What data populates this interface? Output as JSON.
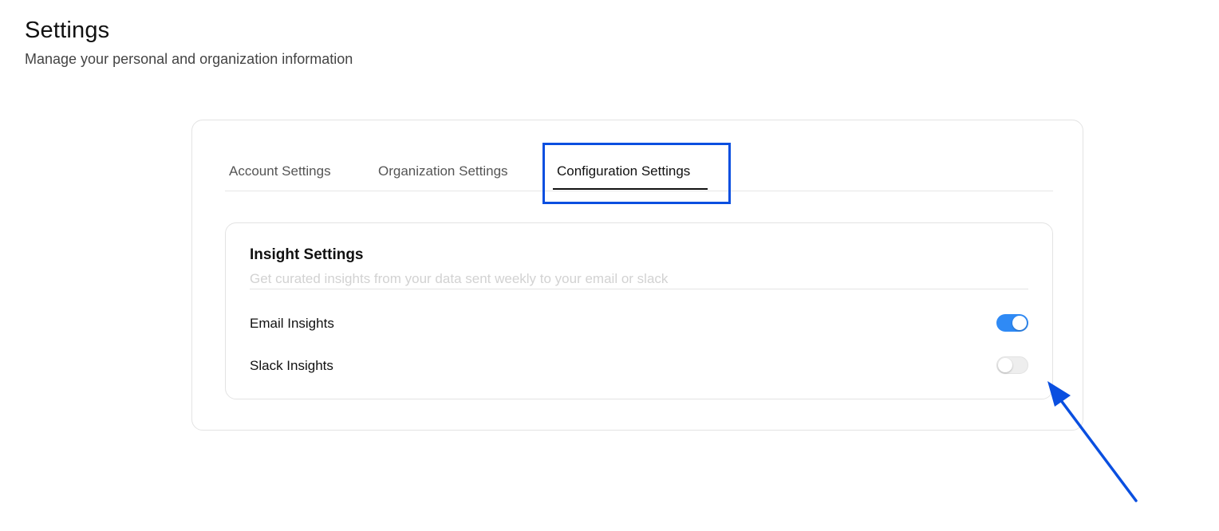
{
  "header": {
    "title": "Settings",
    "subtitle": "Manage your personal and organization information"
  },
  "tabs": [
    {
      "label": "Account Settings",
      "active": false
    },
    {
      "label": "Organization Settings",
      "active": false
    },
    {
      "label": "Configuration Settings",
      "active": true
    }
  ],
  "insight_settings": {
    "title": "Insight Settings",
    "description": "Get curated insights from your data sent weekly to your email or slack",
    "items": [
      {
        "label": "Email Insights",
        "enabled": true
      },
      {
        "label": "Slack Insights",
        "enabled": false
      }
    ]
  },
  "colors": {
    "accent": "#2f8af5",
    "annotation": "#0a4fe0"
  }
}
